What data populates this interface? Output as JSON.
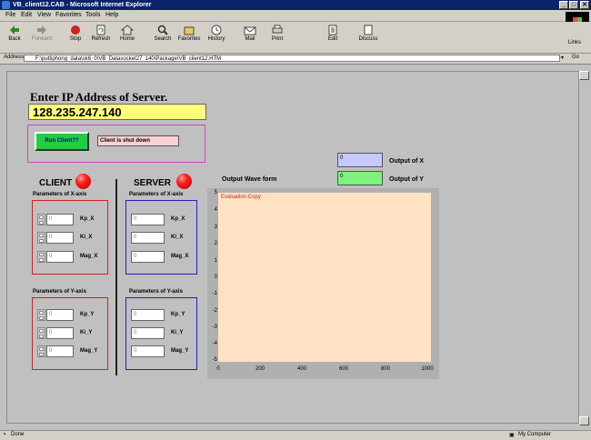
{
  "window": {
    "title": "VB_client12.CAB - Microsoft Internet Explorer",
    "controls": [
      "_",
      "□",
      "✕"
    ]
  },
  "menubar": {
    "items": [
      "File",
      "Edit",
      "View",
      "Favorites",
      "Tools",
      "Help"
    ]
  },
  "toolbar": {
    "buttons": [
      "Back",
      "Forward",
      "Stop",
      "Refresh",
      "Home",
      "Search",
      "Favorites",
      "History",
      "Mail",
      "Print",
      "Edit",
      "Discuss"
    ],
    "links_label": "Links"
  },
  "address": {
    "label": "Address",
    "value": "F:\\puttiphong_data\\sk6_0\\VB_Datasocket27_140\\Package\\VB_client12.HTM",
    "go_label": "Go"
  },
  "app": {
    "ip_title": "Enter IP Address of Server.",
    "ip_value": "128.235.247.140",
    "run_button": "Run Client??",
    "status_text": "Client is shut down",
    "client": {
      "header": "CLIENT",
      "x_params_label": "Parameters of X-axis",
      "y_params_label": "Parameters of Y-axis",
      "x_rows": [
        {
          "value": "0",
          "label": "Kp_X"
        },
        {
          "value": "0",
          "label": "Ki_X"
        },
        {
          "value": "0",
          "label": "Mag_X"
        }
      ],
      "y_rows": [
        {
          "value": "0",
          "label": "Kp_Y"
        },
        {
          "value": "0",
          "label": "Ki_Y"
        },
        {
          "value": "0",
          "label": "Mag_Y"
        }
      ]
    },
    "server": {
      "header": "SERVER",
      "x_params_label": "Parameters of X-axis",
      "y_params_label": "Parameters of Y-axis",
      "x_rows": [
        {
          "value": "0",
          "label": "Kp_X"
        },
        {
          "value": "0",
          "label": "Ki_X"
        },
        {
          "value": "0",
          "label": "Mag_X"
        }
      ],
      "y_rows": [
        {
          "value": "0",
          "label": "Kp_Y"
        },
        {
          "value": "0",
          "label": "Ki_Y"
        },
        {
          "value": "0",
          "label": "Mag_Y"
        }
      ]
    },
    "output_x": {
      "value": "0",
      "label": "Output of X"
    },
    "output_y": {
      "value": "0",
      "label": "Output of Y"
    },
    "wave_title": "Output Wave form",
    "plot": {
      "watermark": "Evaluation Copy",
      "y_ticks": [
        "5",
        "4",
        "3",
        "2",
        "1",
        "0",
        "-1",
        "-2",
        "-3",
        "-4",
        "-5"
      ],
      "x_ticks": [
        "0",
        "200",
        "400",
        "600",
        "800",
        "1000"
      ]
    }
  },
  "statusbar": {
    "left": "Done",
    "zone": "My Computer"
  },
  "colors": {
    "ip_field": "#fffd7c",
    "run_button": "#22cc44",
    "status_field": "#fcd0d0",
    "output_x": "#c8c8ff",
    "output_y": "#80f080",
    "plot_bg": "#ffe2c4",
    "led": "#ff2020"
  }
}
